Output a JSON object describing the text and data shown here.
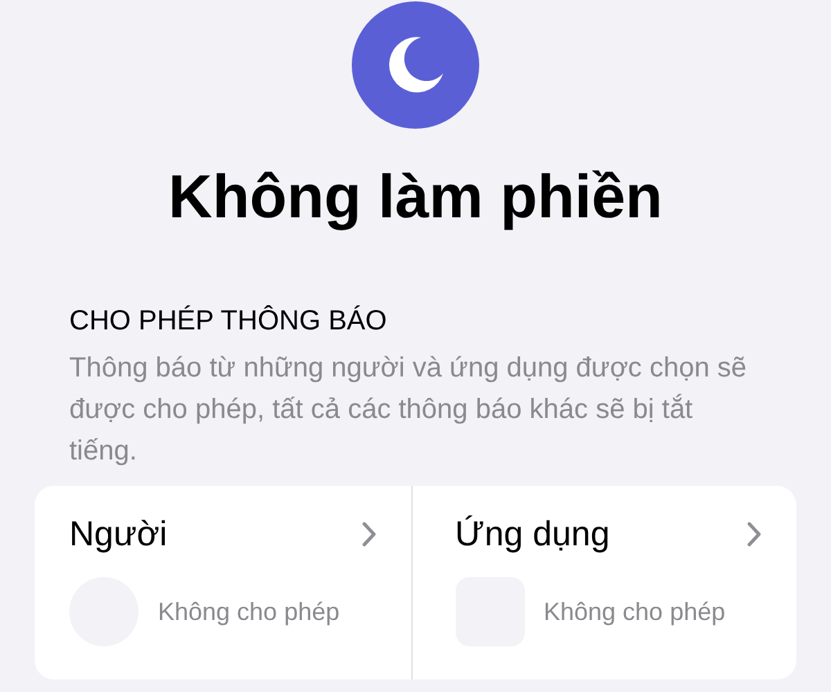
{
  "title": "Không làm phiền",
  "section": {
    "header": "CHO PHÉP THÔNG BÁO",
    "description": "Thông báo từ những người và ứng dụng được chọn sẽ được cho phép, tất cả các thông báo khác sẽ bị tắt tiếng."
  },
  "options": [
    {
      "label": "Người",
      "kind": "people",
      "status": "Không cho phép"
    },
    {
      "label": "Ứng dụng",
      "kind": "apps",
      "status": "Không cho phép"
    }
  ]
}
